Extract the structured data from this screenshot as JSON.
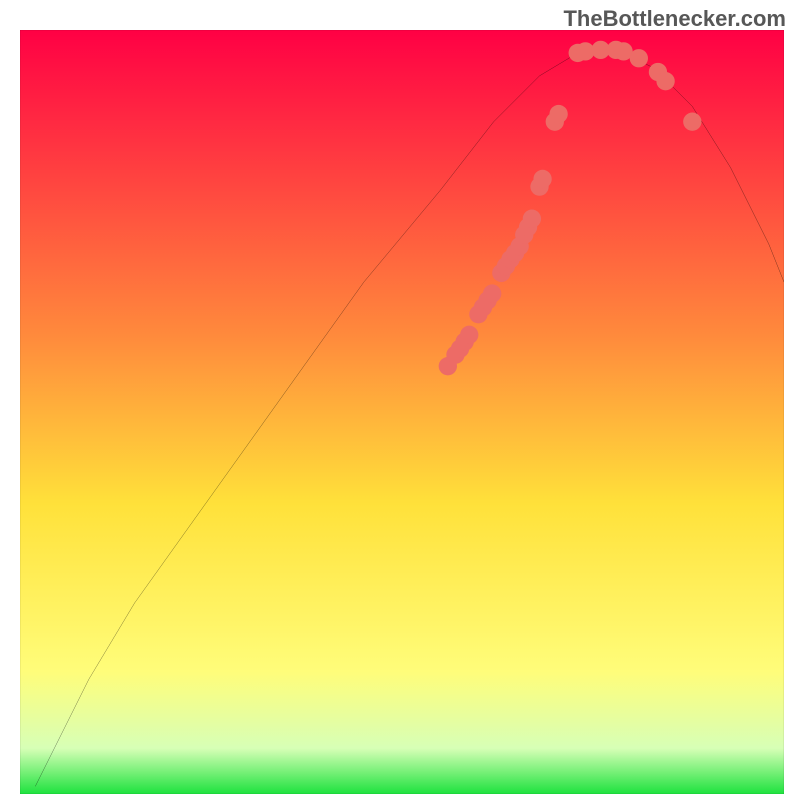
{
  "branding": "TheBottlenecker.com",
  "chart_data": {
    "type": "line",
    "title": "",
    "xlabel": "",
    "ylabel": "",
    "xlim": [
      0,
      100
    ],
    "ylim": [
      0,
      100
    ],
    "curve": [
      {
        "x": 2,
        "y": 1
      },
      {
        "x": 5,
        "y": 7
      },
      {
        "x": 9,
        "y": 15
      },
      {
        "x": 15,
        "y": 25
      },
      {
        "x": 25,
        "y": 39
      },
      {
        "x": 35,
        "y": 53
      },
      {
        "x": 45,
        "y": 67
      },
      {
        "x": 55,
        "y": 79
      },
      {
        "x": 62,
        "y": 88
      },
      {
        "x": 68,
        "y": 94
      },
      {
        "x": 73,
        "y": 97
      },
      {
        "x": 78,
        "y": 97.5
      },
      {
        "x": 83,
        "y": 95
      },
      {
        "x": 88,
        "y": 90
      },
      {
        "x": 93,
        "y": 82
      },
      {
        "x": 98,
        "y": 72
      },
      {
        "x": 100,
        "y": 67
      }
    ],
    "markers": {
      "color": "#ed6b66",
      "r": 1.2,
      "points": [
        {
          "x": 56,
          "y": 56
        },
        {
          "x": 57,
          "y": 57.5
        },
        {
          "x": 57.6,
          "y": 58.3
        },
        {
          "x": 58.2,
          "y": 59.2
        },
        {
          "x": 58.8,
          "y": 60.1
        },
        {
          "x": 60,
          "y": 62.8
        },
        {
          "x": 60.6,
          "y": 63.7
        },
        {
          "x": 61.2,
          "y": 64.6
        },
        {
          "x": 61.8,
          "y": 65.5
        },
        {
          "x": 63,
          "y": 68.2
        },
        {
          "x": 63.6,
          "y": 69.1
        },
        {
          "x": 64.2,
          "y": 70
        },
        {
          "x": 64.8,
          "y": 70.8
        },
        {
          "x": 65.4,
          "y": 71.7
        },
        {
          "x": 66,
          "y": 73.2
        },
        {
          "x": 66.5,
          "y": 74.2
        },
        {
          "x": 67,
          "y": 75.3
        },
        {
          "x": 68,
          "y": 79.5
        },
        {
          "x": 68.4,
          "y": 80.5
        },
        {
          "x": 70,
          "y": 88
        },
        {
          "x": 70.5,
          "y": 89
        },
        {
          "x": 73,
          "y": 97
        },
        {
          "x": 74,
          "y": 97.2
        },
        {
          "x": 76,
          "y": 97.4
        },
        {
          "x": 78,
          "y": 97.4
        },
        {
          "x": 79,
          "y": 97.2
        },
        {
          "x": 81,
          "y": 96.3
        },
        {
          "x": 83.5,
          "y": 94.5
        },
        {
          "x": 84.5,
          "y": 93.3
        },
        {
          "x": 88,
          "y": 88
        }
      ]
    },
    "gradient_stops": [
      {
        "offset": 0,
        "color": "#ff0044"
      },
      {
        "offset": 40,
        "color": "#ff8a3c"
      },
      {
        "offset": 62,
        "color": "#ffe13a"
      },
      {
        "offset": 84,
        "color": "#fffd7a"
      },
      {
        "offset": 94,
        "color": "#d7ffb6"
      },
      {
        "offset": 100,
        "color": "#1ee23e"
      }
    ]
  }
}
